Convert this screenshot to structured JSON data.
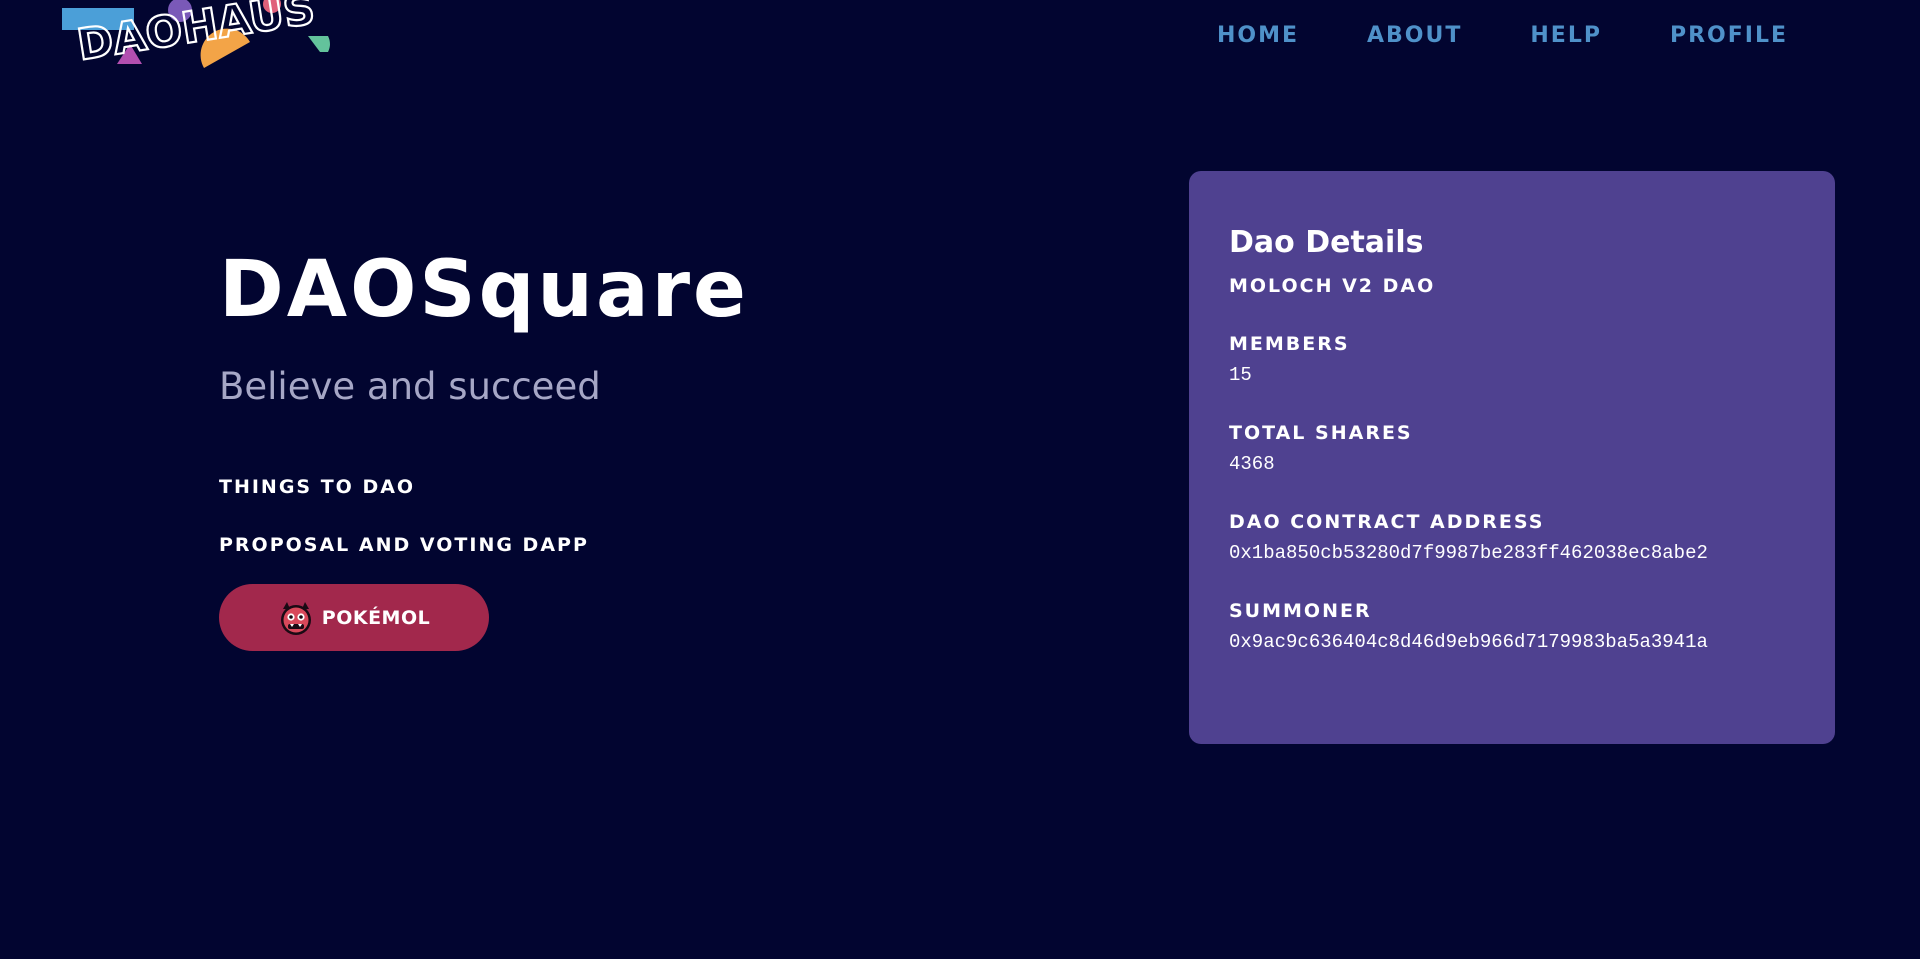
{
  "header": {
    "logo_text": "DAOHAUS",
    "nav": [
      {
        "label": "HOME"
      },
      {
        "label": "ABOUT"
      },
      {
        "label": "HELP"
      },
      {
        "label": "PROFILE"
      }
    ]
  },
  "hero": {
    "title": "DAOSquare",
    "tagline": "Believe and succeed",
    "links": [
      {
        "label": "THINGS TO DAO"
      },
      {
        "label": "PROPOSAL AND VOTING DAPP"
      }
    ],
    "app_button": {
      "label": "POKÉMOL",
      "icon": "pokemol-monster-icon"
    }
  },
  "details": {
    "title": "Dao Details",
    "version": "MOLOCH V2 DAO",
    "members_label": "MEMBERS",
    "members_value": "15",
    "shares_label": "TOTAL SHARES",
    "shares_value": "4368",
    "contract_label": "DAO CONTRACT ADDRESS",
    "contract_value": "0x1ba850cb53280d7f9987be283ff462038ec8abe2",
    "summoner_label": "SUMMONER",
    "summoner_value": "0x9ac9c636404c8d46d9eb966d7179983ba5a3941a"
  },
  "colors": {
    "background": "#020530",
    "nav_link": "#4f91c9",
    "card": "#4f4190",
    "button": "#a2284c",
    "tagline": "#a6a7c6"
  }
}
